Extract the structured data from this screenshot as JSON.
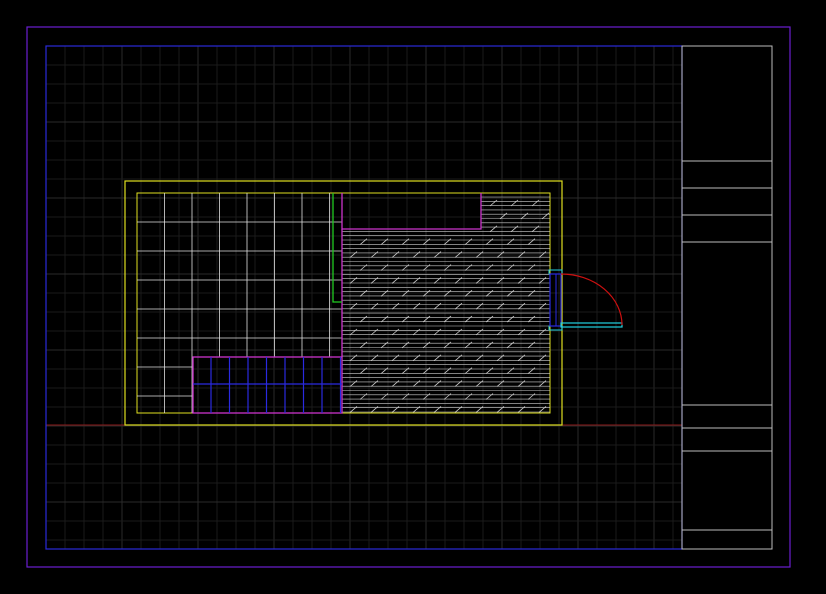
{
  "drawing": {
    "background": "#000000",
    "colors": {
      "outer_border": "#6a1fd0",
      "inner_border": "#2a2ad8",
      "title_block": "#bdbdbd",
      "grid_major": "#2a2a2a",
      "grid_minor": "#1a1a1a",
      "axis_line": "#8a1a1a",
      "wall": "#e0e020",
      "interior_line": "#e0e0e0",
      "partition": "#cc33cc",
      "green_partition": "#22cc22",
      "stair": "#2a2ae0",
      "hatch": "#cfcfcf",
      "door_frame": "#22d0e0",
      "door_swing": "#cc1010"
    },
    "title_block_rows": 8
  }
}
